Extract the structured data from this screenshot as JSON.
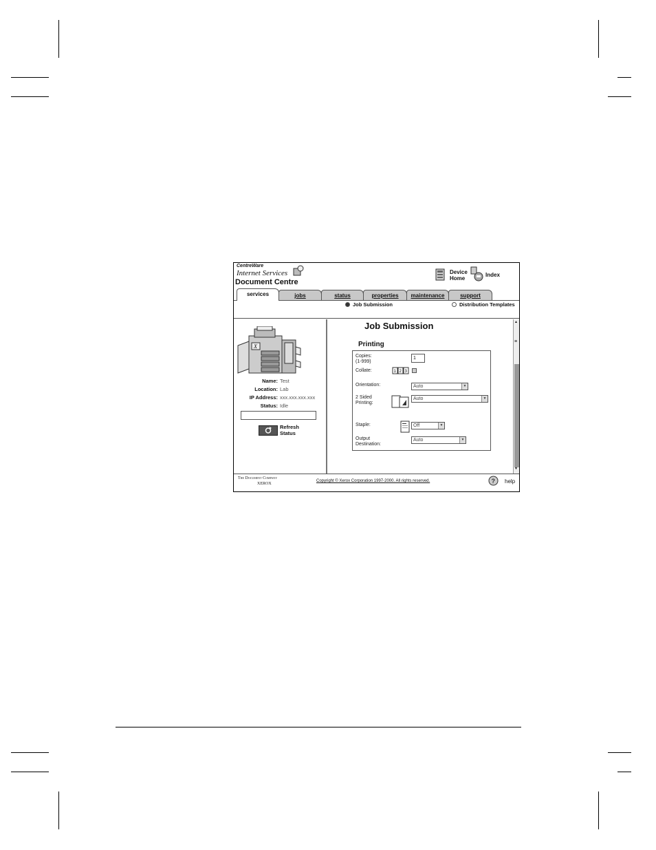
{
  "app": {
    "brand_line1": "CentreWare",
    "brand_line2": "Internet Services",
    "product": "Document Centre"
  },
  "top_links": {
    "device_home_line1": "Device",
    "device_home_line2": "Home",
    "index": "Index"
  },
  "tabs": [
    {
      "label": "services",
      "active": true
    },
    {
      "label": "jobs",
      "active": false
    },
    {
      "label": "status",
      "active": false
    },
    {
      "label": "properties",
      "active": false
    },
    {
      "label": "maintenance",
      "active": false
    },
    {
      "label": "support",
      "active": false
    }
  ],
  "subnav": {
    "job_submission": "Job Submission",
    "distribution_templates": "Distribution Templates",
    "selected": "job_submission"
  },
  "device": {
    "name_label": "Name:",
    "name_value": "Test",
    "location_label": "Location:",
    "location_value": "Lab",
    "ip_label": "IP Address:",
    "ip_value": "xxx.xxx.xxx.xxx",
    "status_label": "Status:",
    "status_value": "Idle",
    "refresh_line1": "Refresh",
    "refresh_line2": "Status"
  },
  "main": {
    "title": "Job Submission",
    "section": "Printing",
    "copies_label_1": "Copies:",
    "copies_label_2": "(1-999)",
    "copies_value": "1",
    "collate_label": "Collate:",
    "orientation_label": "Orientation:",
    "orientation_value": "Auto",
    "two_sided_label_1": "2 Sided",
    "two_sided_label_2": "Printing:",
    "two_sided_value": "Auto",
    "staple_label": "Staple:",
    "staple_value": "Off",
    "output_label_1": "Output",
    "output_label_2": "Destination:",
    "output_value": "Auto"
  },
  "footer": {
    "company_line1": "The Document Company",
    "company_line2": "XEROX",
    "copyright": "Copyright © Xerox Corporation 1997-2000. All rights reserved.",
    "help": "help"
  }
}
